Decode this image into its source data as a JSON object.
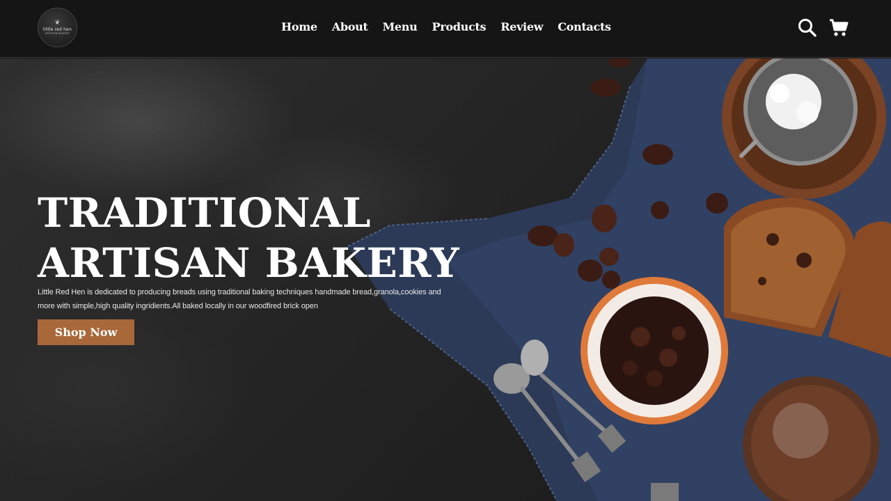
{
  "brand": {
    "logo_name": "little red hen",
    "logo_sub": "ARTISAN BAKERY"
  },
  "nav": {
    "items": [
      {
        "label": "Home"
      },
      {
        "label": "About"
      },
      {
        "label": "Menu"
      },
      {
        "label": "Products"
      },
      {
        "label": "Review"
      },
      {
        "label": "Contacts"
      }
    ]
  },
  "icons": {
    "search": "search-icon",
    "cart": "shopping-cart-icon"
  },
  "hero": {
    "title_line1": "TRADITIONAL",
    "title_line2": "ARTISAN BAKERY",
    "description": "Little Red Hen is dedicated to producing breads using traditional baking techniques handmade bread,granola,cookies and more with simple,high quality ingridients.All baked locally in our woodfired brick open",
    "cta_label": "Shop Now"
  },
  "colors": {
    "header_bg": "#151515",
    "accent": "#a8683a",
    "text": "#ffffff"
  }
}
